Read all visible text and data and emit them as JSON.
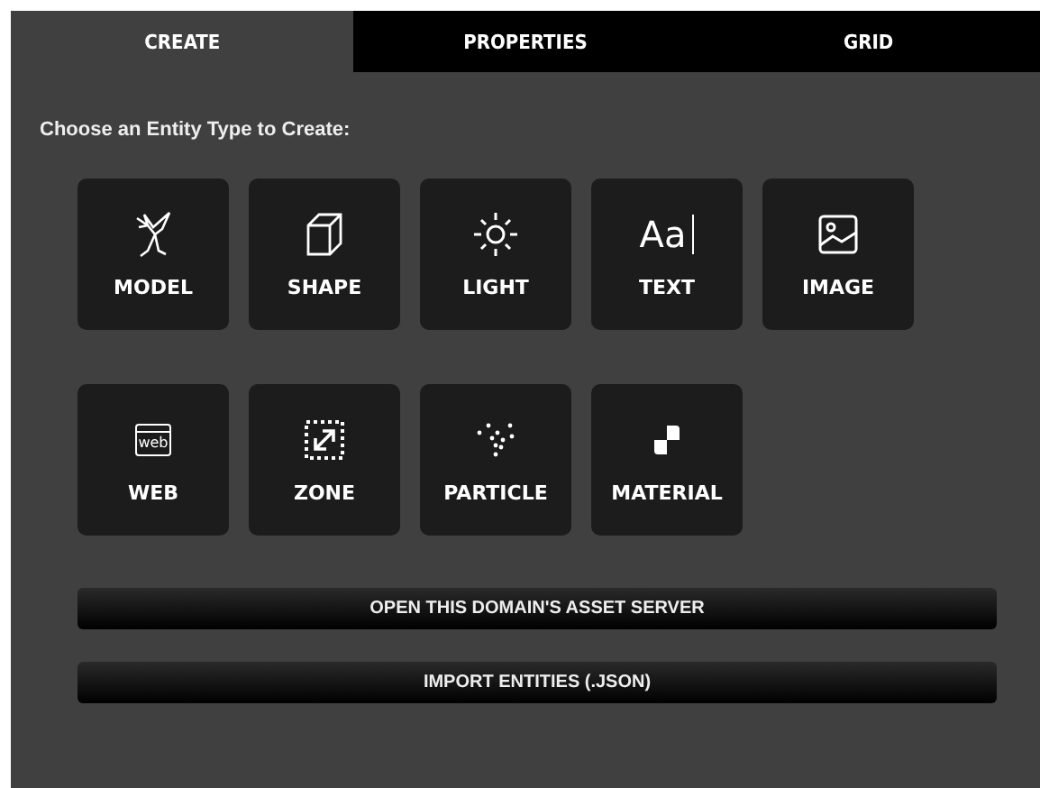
{
  "tabs": [
    {
      "label": "CREATE",
      "selected": true
    },
    {
      "label": "PROPERTIES",
      "selected": false
    },
    {
      "label": "GRID",
      "selected": false
    }
  ],
  "prompt": "Choose an Entity Type to Create:",
  "entity_types": [
    {
      "kind": "model",
      "label": "MODEL"
    },
    {
      "kind": "shape",
      "label": "SHAPE"
    },
    {
      "kind": "light",
      "label": "LIGHT"
    },
    {
      "kind": "text",
      "label": "TEXT",
      "glyph": "Aa"
    },
    {
      "kind": "image",
      "label": "IMAGE"
    },
    {
      "kind": "web",
      "label": "WEB",
      "glyph": "web"
    },
    {
      "kind": "zone",
      "label": "ZONE"
    },
    {
      "kind": "particle",
      "label": "PARTICLE"
    },
    {
      "kind": "material",
      "label": "MATERIAL"
    }
  ],
  "buttons": [
    "OPEN THIS DOMAIN'S ASSET SERVER",
    "IMPORT ENTITIES (.JSON)"
  ]
}
